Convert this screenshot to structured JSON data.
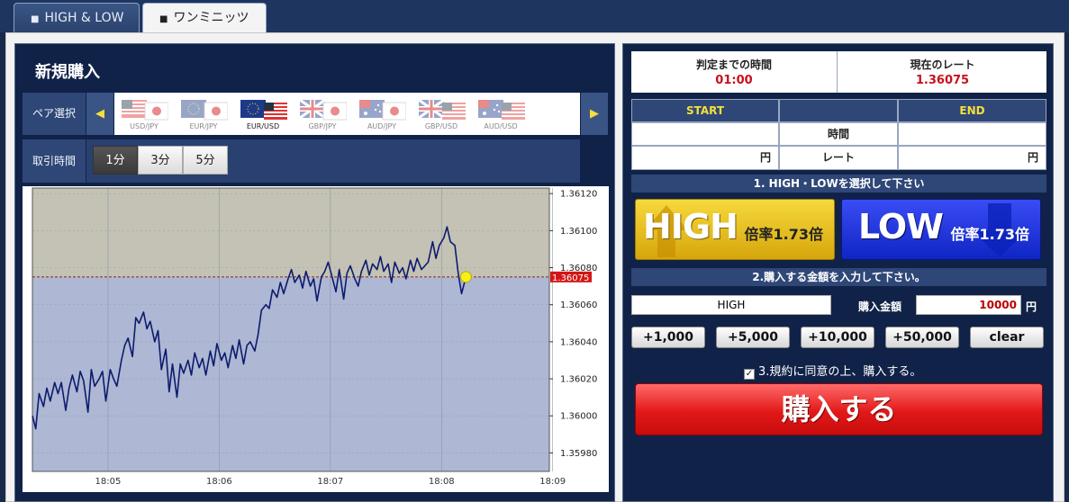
{
  "tabs": [
    {
      "label": "HIGH & LOW",
      "active": false
    },
    {
      "label": "ワンミニッツ",
      "active": true
    }
  ],
  "left": {
    "title": "新規購入",
    "pair_label": "ペア選択",
    "pairs": [
      {
        "code": "USD/JPY",
        "active": false
      },
      {
        "code": "EUR/JPY",
        "active": false
      },
      {
        "code": "EUR/USD",
        "active": true
      },
      {
        "code": "GBP/JPY",
        "active": false
      },
      {
        "code": "AUD/JPY",
        "active": false
      },
      {
        "code": "GBP/USD",
        "active": false
      },
      {
        "code": "AUD/USD",
        "active": false
      }
    ],
    "time_label": "取引時間",
    "time_options": [
      {
        "label": "1分",
        "selected": true
      },
      {
        "label": "3分",
        "selected": false
      },
      {
        "label": "5分",
        "selected": false
      }
    ]
  },
  "chart_data": {
    "type": "line",
    "x_ticks": [
      "18:05",
      "18:06",
      "18:07",
      "18:08",
      "18:09"
    ],
    "y_ticks": [
      "1.36120",
      "1.36100",
      "1.36080",
      "1.36060",
      "1.36040",
      "1.36020",
      "1.36000",
      "1.35980"
    ],
    "ylim": [
      1.3597,
      1.36123
    ],
    "current_rate_label": "1.36075",
    "current_rate": 1.36075,
    "x_range_minutes": [
      0,
      4.65
    ],
    "series": [
      {
        "x": [
          0,
          0.03,
          0.06,
          0.1,
          0.13,
          0.16,
          0.2,
          0.23,
          0.26,
          0.3,
          0.33,
          0.36,
          0.4,
          0.43,
          0.46,
          0.5,
          0.53,
          0.56,
          0.6,
          0.63,
          0.66,
          0.7,
          0.73,
          0.76,
          0.8,
          0.83,
          0.86,
          0.9,
          0.93,
          0.96,
          1.0,
          1.03,
          1.06,
          1.1,
          1.13,
          1.16,
          1.2,
          1.23,
          1.26,
          1.3,
          1.33,
          1.36,
          1.4,
          1.43,
          1.46,
          1.5,
          1.53,
          1.56,
          1.6,
          1.63,
          1.66,
          1.7,
          1.73,
          1.76,
          1.8,
          1.83,
          1.86,
          1.9,
          1.93,
          1.96,
          2.0,
          2.03,
          2.06,
          2.1,
          2.13,
          2.16,
          2.2,
          2.23,
          2.26,
          2.3,
          2.33,
          2.36,
          2.4,
          2.43,
          2.46,
          2.5,
          2.53,
          2.56,
          2.6,
          2.63,
          2.66,
          2.7,
          2.73,
          2.76,
          2.8,
          2.83,
          2.86,
          2.9,
          2.93,
          2.96,
          3.0,
          3.03,
          3.06,
          3.1,
          3.13,
          3.16,
          3.2,
          3.23,
          3.26,
          3.3,
          3.33,
          3.36,
          3.4,
          3.43,
          3.46,
          3.5,
          3.53,
          3.56,
          3.6,
          3.63,
          3.66,
          3.7,
          3.73,
          3.76,
          3.8,
          3.83,
          3.86,
          3.9
        ],
        "y": [
          1.36,
          1.35993,
          1.36012,
          1.36005,
          1.36015,
          1.36008,
          1.36018,
          1.36012,
          1.36018,
          1.36003,
          1.36015,
          1.36022,
          1.36013,
          1.36024,
          1.36019,
          1.36002,
          1.36025,
          1.36016,
          1.3602,
          1.36024,
          1.36008,
          1.36025,
          1.3602,
          1.36016,
          1.3603,
          1.36038,
          1.36042,
          1.36032,
          1.36053,
          1.3605,
          1.36056,
          1.36047,
          1.36051,
          1.3604,
          1.36046,
          1.36025,
          1.36036,
          1.36013,
          1.36028,
          1.3601,
          1.36028,
          1.36023,
          1.3603,
          1.36022,
          1.36034,
          1.36026,
          1.36031,
          1.36022,
          1.36035,
          1.36027,
          1.36039,
          1.3603,
          1.36034,
          1.36026,
          1.36038,
          1.36031,
          1.36041,
          1.36028,
          1.36038,
          1.3604,
          1.36035,
          1.36044,
          1.36057,
          1.3606,
          1.36058,
          1.36068,
          1.36064,
          1.36072,
          1.36066,
          1.36074,
          1.36079,
          1.36072,
          1.36076,
          1.36069,
          1.36078,
          1.3607,
          1.36074,
          1.36062,
          1.36075,
          1.36078,
          1.36083,
          1.36074,
          1.36067,
          1.36079,
          1.36063,
          1.36077,
          1.36081,
          1.36074,
          1.3607,
          1.36078,
          1.36084,
          1.36076,
          1.36082,
          1.36079,
          1.36086,
          1.36078,
          1.36082,
          1.36072,
          1.36083,
          1.36077,
          1.3608,
          1.36074,
          1.36084,
          1.36078,
          1.36085,
          1.36079,
          1.36081,
          1.36083,
          1.36094,
          1.36085,
          1.36092,
          1.36096,
          1.36102,
          1.36094,
          1.36092,
          1.36077,
          1.36066,
          1.36075
        ]
      }
    ],
    "grid": true
  },
  "right": {
    "time_label": "判定までの時間",
    "time_value": "01:00",
    "rate_label": "現在のレート",
    "rate_value": "1.36075",
    "start": "START",
    "end": "END",
    "time_row": "時間",
    "rate_row": "レート",
    "yen": "円",
    "step1": "1. HIGH・LOWを選択して下さい",
    "high": {
      "word": "HIGH",
      "rate": "倍率1.73倍"
    },
    "low": {
      "word": "LOW",
      "rate": "倍率1.73倍"
    },
    "step2": "2.購入する金額を入力して下さい。",
    "selected_side": "HIGH",
    "amount_label": "購入金額",
    "amount_value": "10000",
    "amount_buttons": [
      "+1,000",
      "+5,000",
      "+10,000",
      "+50,000",
      "clear"
    ],
    "agree": "3.規約に同意の上、購入する。",
    "agree_checked": true,
    "buy": "購入する"
  },
  "colors": {
    "navy": "#102247",
    "header": "#2f4777",
    "gold": "#f6d93c",
    "blue": "#1a2fe0",
    "red": "#e21818",
    "rate_red": "#c8101c",
    "line": "#0d1b6e"
  }
}
